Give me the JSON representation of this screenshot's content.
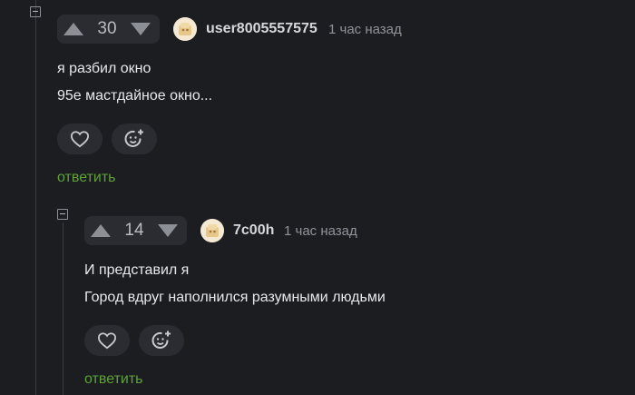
{
  "comments": [
    {
      "rating": "30",
      "username": "user8005557575",
      "time": "1 час назад",
      "lines": [
        "я разбил окно",
        "95е мастдайное окно..."
      ],
      "reply_label": "ответить"
    },
    {
      "rating": "14",
      "username": "7c00h",
      "time": "1 час назад",
      "lines": [
        "И представил я",
        "Город вдруг наполнился разумными людьми"
      ],
      "reply_label": "ответить"
    }
  ],
  "icons": {
    "upvote": "triangle-up-icon",
    "downvote": "triangle-down-icon",
    "like": "heart-icon",
    "reaction": "smiley-plus-icon",
    "collapse": "minus-square-icon"
  },
  "colors": {
    "background": "#1c1d20",
    "panel": "#2b2c31",
    "reply_link": "#5ea13a",
    "username": "#d6d8dc",
    "muted": "#8f939a"
  }
}
